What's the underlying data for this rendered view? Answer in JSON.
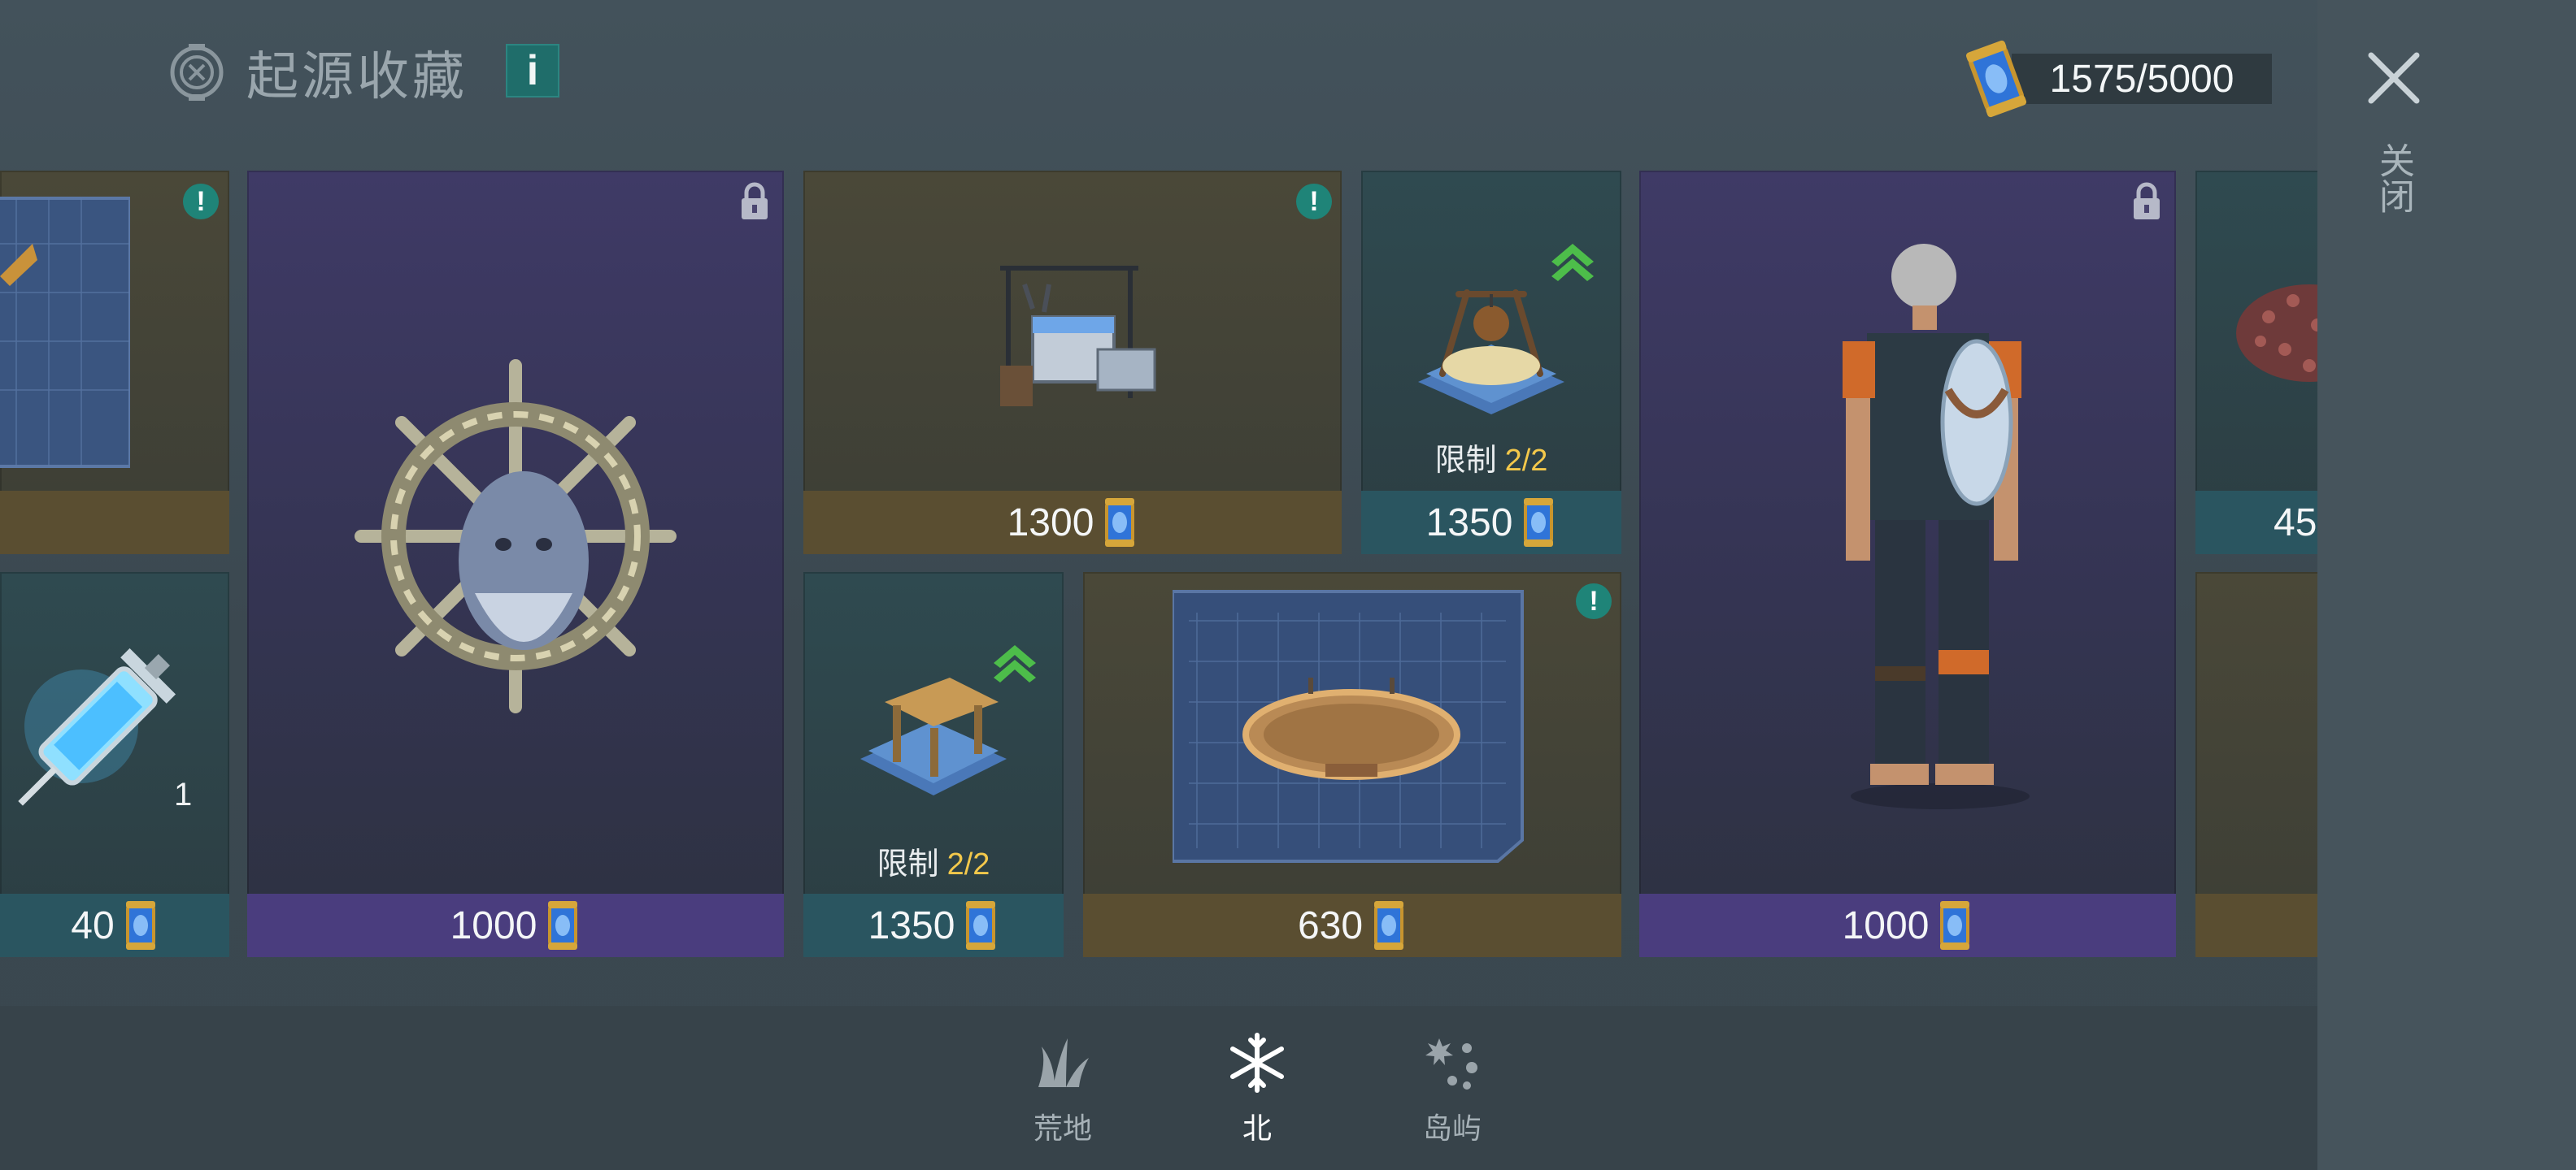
{
  "header": {
    "title": "起源收藏",
    "info_label": "i",
    "currency_value": "1575/5000"
  },
  "sidebar": {
    "close_label": "关闭"
  },
  "cards": {
    "blueprint_left": {
      "price": ""
    },
    "syringe": {
      "price": "40",
      "count": "1"
    },
    "ship_wheel_head": {
      "price": "1000"
    },
    "workbench_set": {
      "price": "1300"
    },
    "campfire_blueprint": {
      "limit_label": "限制",
      "limit_value": "2/2",
      "price": "1350"
    },
    "table_blueprint": {
      "limit_label": "限制",
      "limit_value": "2/2",
      "price": "1350"
    },
    "sign_blueprint": {
      "price": "630"
    },
    "diver_outfit": {
      "price": "1000"
    },
    "seeds": {
      "price": "45"
    }
  },
  "tabs": [
    {
      "label": "荒地",
      "icon": "grass-icon",
      "active": false
    },
    {
      "label": "北",
      "icon": "snowflake-icon",
      "active": true
    },
    {
      "label": "岛屿",
      "icon": "island-icon",
      "active": false
    }
  ],
  "colors": {
    "gold_card": "#5a4e31",
    "teal_card": "#2a5560",
    "purple_card": "#4a3d7e",
    "limit_value": "#f3c84b",
    "badge": "#1f8478"
  }
}
